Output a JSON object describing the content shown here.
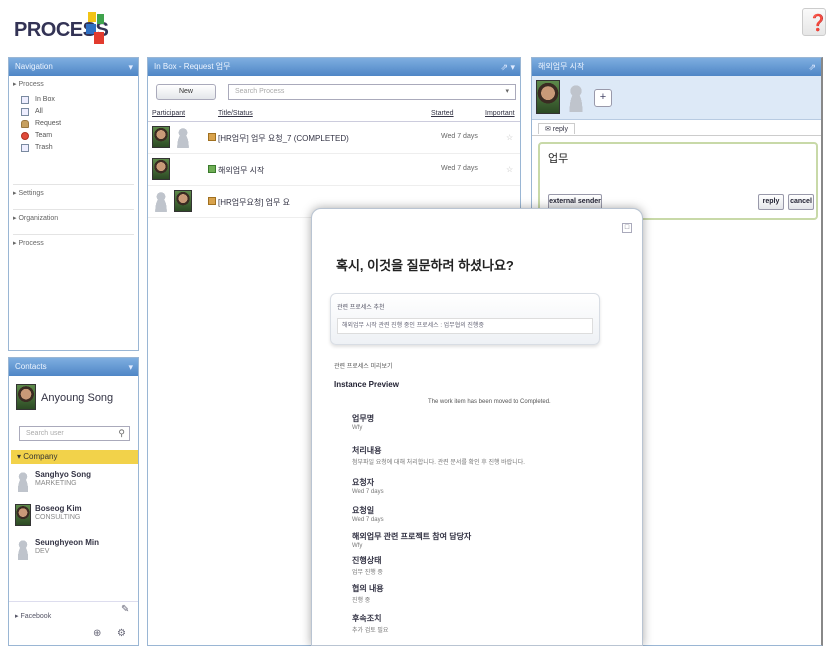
{
  "header": {
    "logo_text": "PROCESS",
    "help_icon": "help-icon",
    "brand_colors": [
      "#f2c416",
      "#3fa34d",
      "#2e6fc2",
      "#e23b2e"
    ]
  },
  "navigation": {
    "title": "Navigation",
    "section_processes": "▸ Process",
    "items": [
      {
        "label": "In Box",
        "icon": "inbox-icon"
      },
      {
        "label": "All",
        "icon": "all-icon"
      },
      {
        "label": "Request",
        "icon": "request-icon"
      },
      {
        "label": "Team",
        "icon": "team-icon"
      },
      {
        "label": "Trash",
        "icon": "trash-icon"
      }
    ],
    "sections": [
      "▸ Settings",
      "▸ Organization",
      "▸ Process"
    ]
  },
  "contacts": {
    "title": "Contacts",
    "me": "Anyoung Song",
    "search_placeholder": "Search user",
    "category": "Company",
    "people": [
      {
        "name": "Sanghyo Song",
        "dept": "MARKETING",
        "photo": false
      },
      {
        "name": "Boseog Kim",
        "dept": "CONSULTING",
        "photo": true
      },
      {
        "name": "Seunghyeon Min",
        "dept": "DEV",
        "photo": false
      }
    ],
    "footer_button": "▸ Facebook"
  },
  "worklist": {
    "title": "In Box - Request 업무",
    "new_button": "New",
    "search_placeholder": "Search Process",
    "columns": [
      "Participant",
      "Title/Status",
      "Started",
      "Important"
    ],
    "rows": [
      {
        "title": "[HR업무] 업무 요청_7 (COMPLETED)",
        "started": "Wed 7 days",
        "important": "☆"
      },
      {
        "title": "해외업무 시작",
        "started": "Wed 7 days",
        "important": "☆"
      },
      {
        "title": "[HR업무요청] 업무 요"
      }
    ]
  },
  "detail": {
    "title": "해외업무 시작",
    "tab": "✉ reply",
    "reply_text": "업무",
    "buttons": {
      "external": "external sender",
      "reply": "reply",
      "cancel": "cancel"
    }
  },
  "popup": {
    "question": "혹시, 이것을 질문하려 하셨나요?",
    "card_title": "관련 프로세스 추천",
    "card_body": "해외업무 시작 관련 진행 중인 프로세스 : 업무협의 진행중",
    "small_label": "관련 프로세스 미리보기",
    "instance_preview": "Instance Preview",
    "centered_note": "The work item has been moved to Completed.",
    "lines": [
      {
        "label": "업무명",
        "value": "Wfy"
      },
      {
        "label": "처리내용",
        "value": "첨부파일 요청에 대해 처리합니다. 관련 문서를 확인 후 진행 바랍니다."
      },
      {
        "label": "요청자",
        "value": "Wed 7 days"
      },
      {
        "label": "요청일",
        "value": "Wed 7 days"
      },
      {
        "label": "해외업무 관련 프로젝트 참여 담당자",
        "value": "Wfy"
      },
      {
        "label": "진행상태",
        "value": "업무 진행 중"
      },
      {
        "label": "협의 내용",
        "value": "진행 중"
      },
      {
        "label": "후속조치",
        "value": "추가 검토 필요"
      }
    ]
  }
}
